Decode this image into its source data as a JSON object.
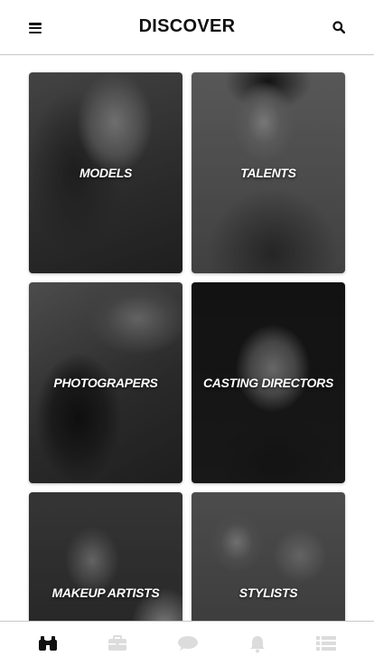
{
  "header": {
    "title": "DISCOVER",
    "menu_icon": "hamburger-menu-icon",
    "search_icon": "search-icon"
  },
  "categories": [
    {
      "label": "MODELS"
    },
    {
      "label": "TALENTS"
    },
    {
      "label": "PHOTOGRAPERS"
    },
    {
      "label": "CASTING DIRECTORS"
    },
    {
      "label": "MAKEUP ARTISTS"
    },
    {
      "label": "STYLISTS"
    }
  ],
  "tabbar": {
    "tabs": [
      {
        "icon": "binoculars-icon",
        "active": true
      },
      {
        "icon": "briefcase-icon",
        "active": false
      },
      {
        "icon": "chat-bubble-icon",
        "active": false
      },
      {
        "icon": "bell-icon",
        "active": false
      },
      {
        "icon": "list-icon",
        "active": false
      }
    ],
    "active_color": "#111111",
    "inactive_color": "#dcdcdc"
  }
}
